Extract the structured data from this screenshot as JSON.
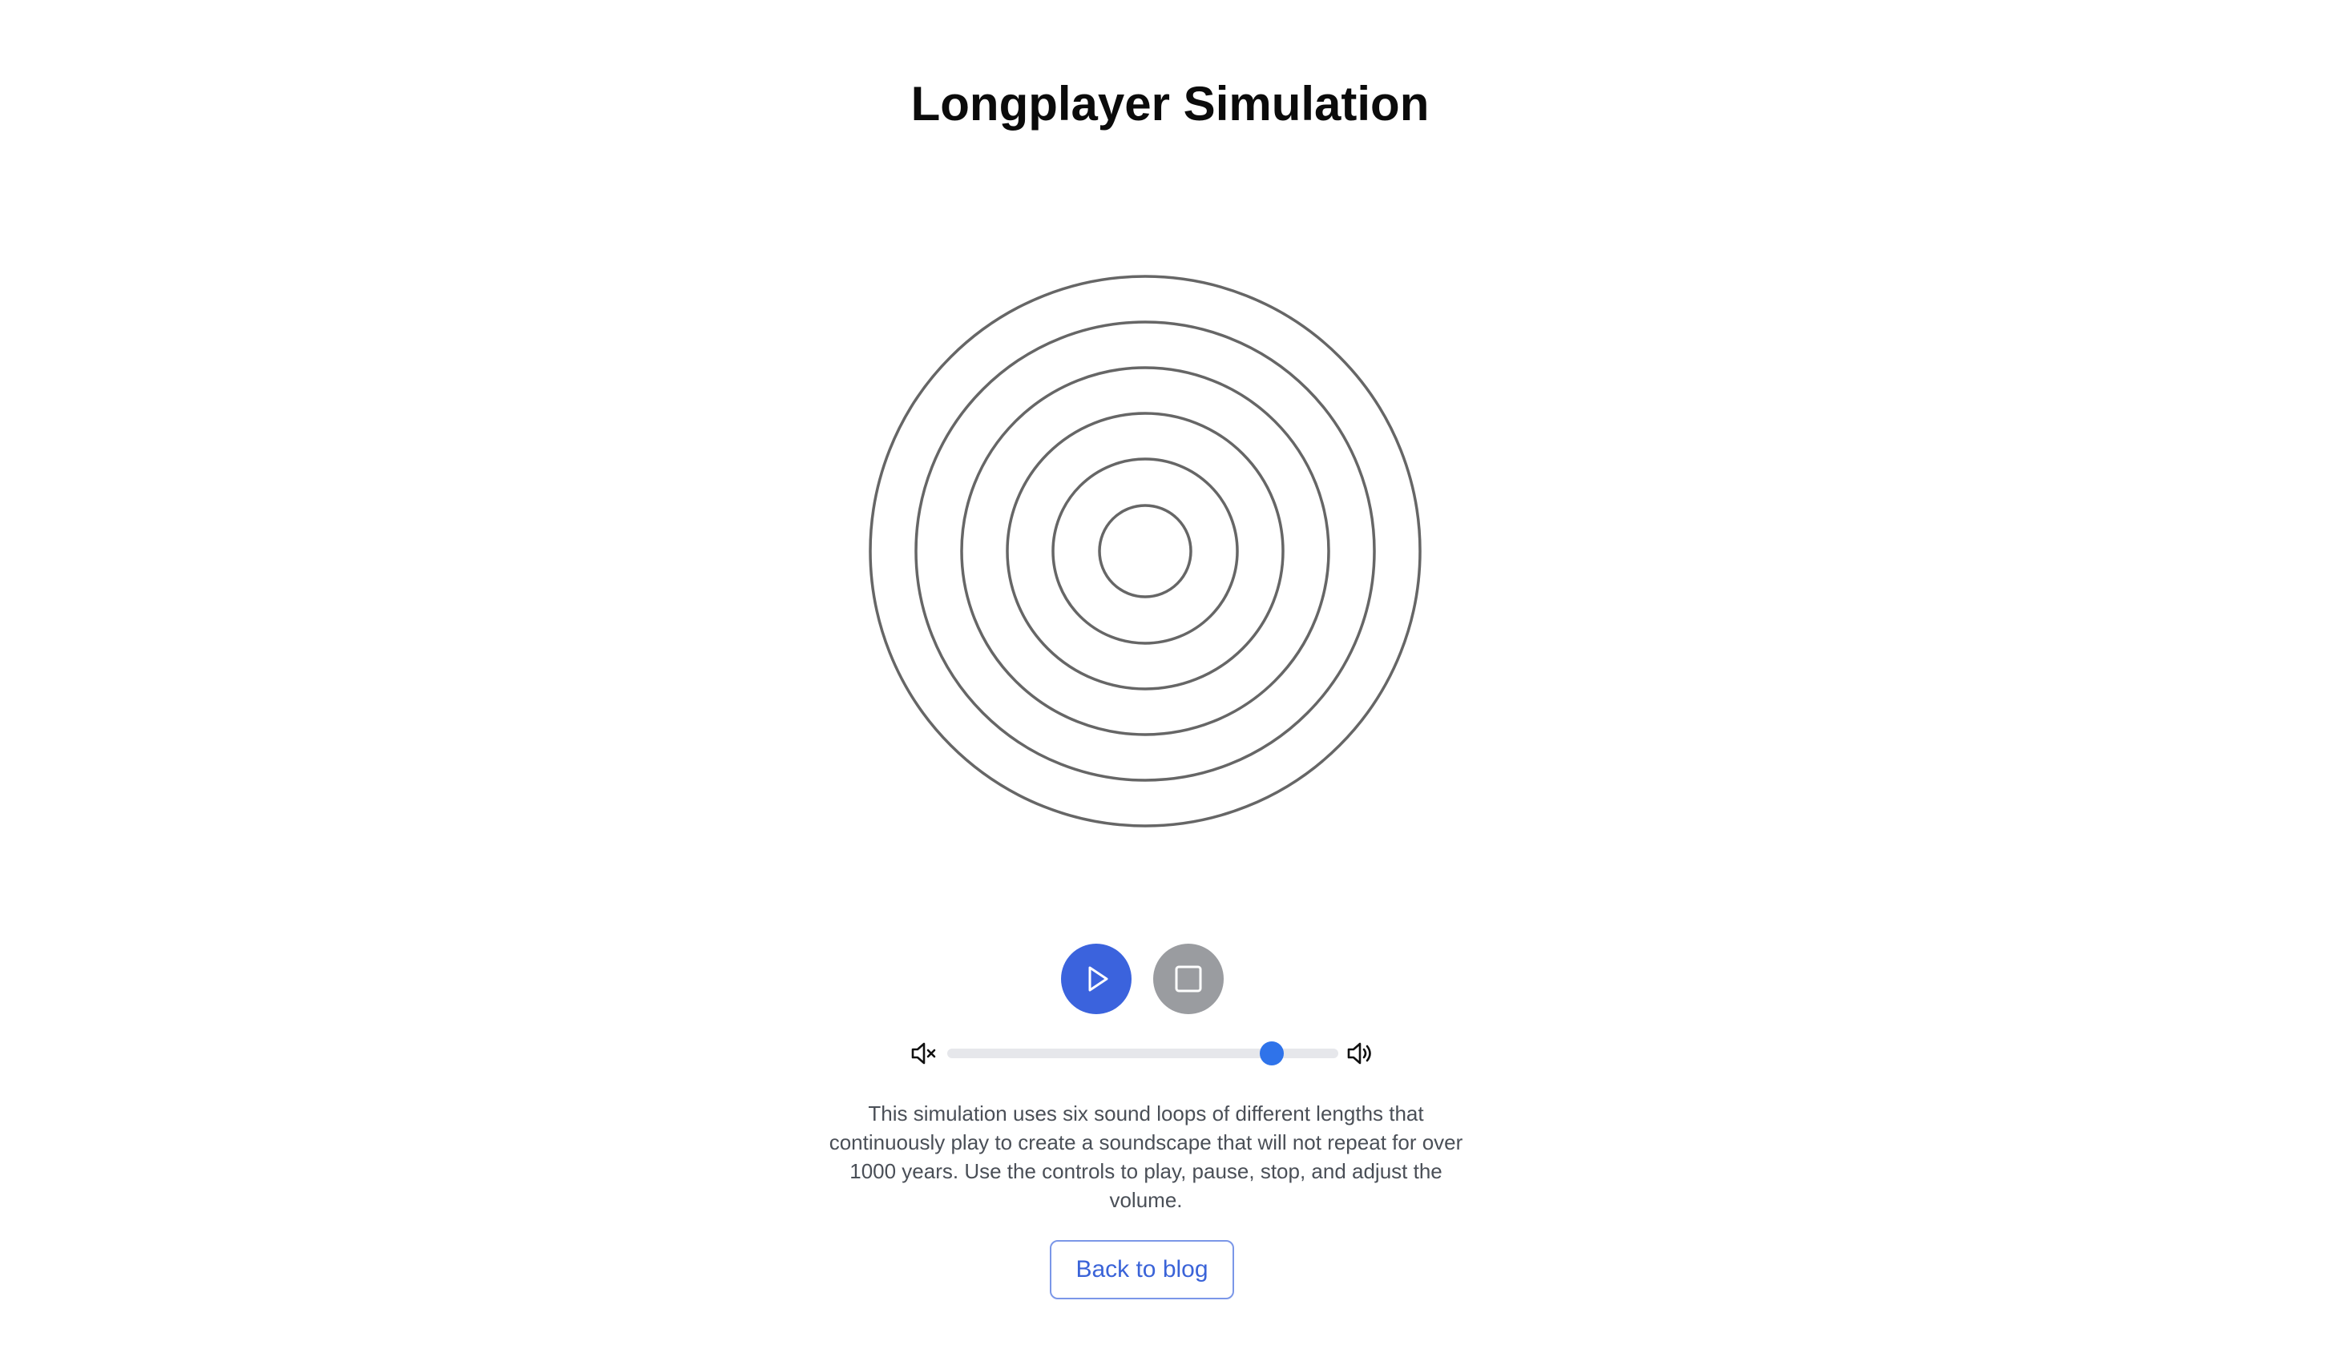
{
  "page": {
    "title": "Longplayer Simulation"
  },
  "visualization": {
    "ring_count": 6,
    "ring_color": "#666666"
  },
  "controls": {
    "play": {
      "icon": "play-icon",
      "color": "#3b63dd"
    },
    "stop": {
      "icon": "stop-icon",
      "color": "#9a9ca0"
    }
  },
  "volume": {
    "min_icon": "volume-mute-icon",
    "max_icon": "volume-high-icon",
    "level": 0.83,
    "accent": "#2f73ea"
  },
  "description": "This simulation uses six sound loops of different lengths that continuously play to create a soundscape that will not repeat for over 1000 years. Use the controls to play, pause, stop, and adjust the volume.",
  "back_link": {
    "label": "Back to blog"
  }
}
